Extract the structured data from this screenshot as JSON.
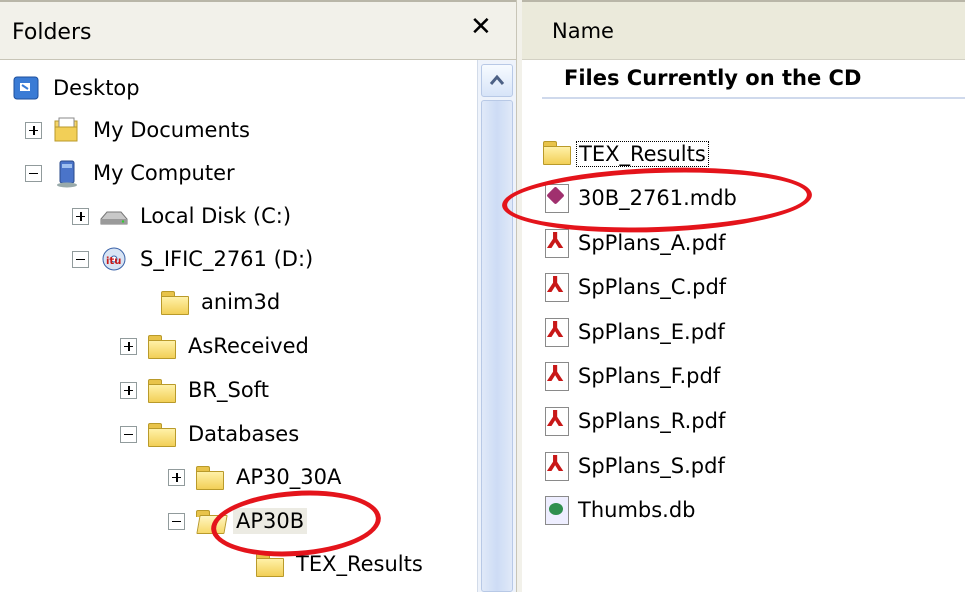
{
  "folders_pane": {
    "title": "Folders",
    "close_glyph": "✕",
    "tree": [
      {
        "label": "Desktop",
        "icon": "desktop-icon",
        "expander": "none"
      },
      {
        "label": "My Documents",
        "icon": "my-documents-icon",
        "expander": "plus"
      },
      {
        "label": "My Computer",
        "icon": "my-computer-icon",
        "expander": "minus"
      },
      {
        "label": "Local Disk (C:)",
        "icon": "hard-disk-icon",
        "expander": "plus"
      },
      {
        "label": "S_IFIC_2761 (D:)",
        "icon": "cd-drive-icon",
        "expander": "minus"
      },
      {
        "label": "anim3d",
        "icon": "folder-icon",
        "expander": "none"
      },
      {
        "label": "AsReceived",
        "icon": "folder-icon",
        "expander": "plus"
      },
      {
        "label": "BR_Soft",
        "icon": "folder-icon",
        "expander": "plus"
      },
      {
        "label": "Databases",
        "icon": "folder-icon",
        "expander": "minus"
      },
      {
        "label": "AP30_30A",
        "icon": "folder-icon",
        "expander": "plus"
      },
      {
        "label": "AP30B",
        "icon": "open-folder-icon",
        "expander": "minus",
        "selected": true
      },
      {
        "label": "TEX_Results",
        "icon": "folder-icon",
        "expander": "none"
      }
    ]
  },
  "files_pane": {
    "column_header": "Name",
    "caption": "Files Currently on the CD",
    "files": [
      {
        "name": "TEX_Results",
        "icon": "folder-icon",
        "focused": true
      },
      {
        "name": "30B_2761.mdb",
        "icon": "access-database-icon"
      },
      {
        "name": "SpPlans_A.pdf",
        "icon": "pdf-icon"
      },
      {
        "name": "SpPlans_C.pdf",
        "icon": "pdf-icon"
      },
      {
        "name": "SpPlans_E.pdf",
        "icon": "pdf-icon"
      },
      {
        "name": "SpPlans_F.pdf",
        "icon": "pdf-icon"
      },
      {
        "name": "SpPlans_R.pdf",
        "icon": "pdf-icon"
      },
      {
        "name": "SpPlans_S.pdf",
        "icon": "pdf-icon"
      },
      {
        "name": "Thumbs.db",
        "icon": "thumbs-db-icon"
      }
    ]
  },
  "colors": {
    "highlight_ring": "#e4141b",
    "header_bg": "#ebeadb",
    "selection_bg": "#ecebe3"
  }
}
